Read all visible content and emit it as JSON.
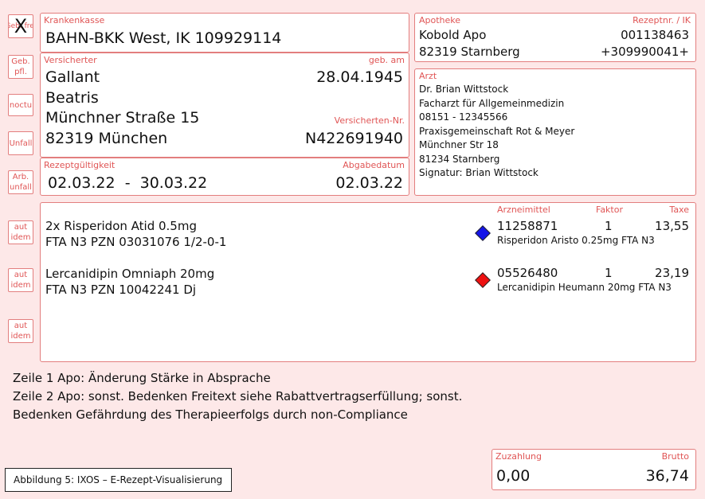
{
  "side_boxes": {
    "gebuehr_frei": {
      "mark": "X",
      "label": "Geb. frei"
    },
    "geb_pfl": [
      "Geb.",
      "pfl."
    ],
    "noctu": "noctu",
    "unfall": "Unfall",
    "arb_unfall": [
      "Arb.",
      "unfall"
    ],
    "aut_idem": [
      "aut",
      "idem"
    ]
  },
  "krankenkasse": {
    "label": "Krankenkasse",
    "value": "BAHN-BKK West, IK 109929114"
  },
  "versicherter": {
    "label": "Versicherter",
    "geb_label": "geb. am",
    "nachname": "Gallant",
    "geb_am": "28.04.1945",
    "vorname": "Beatris",
    "strasse": "Münchner Straße 15",
    "nr_label": "Versicherten-Nr.",
    "ort": "82319 München",
    "nr": "N422691940"
  },
  "gueltigkeit": {
    "label": "Rezeptgültigkeit",
    "value": "02.03.22  -  30.03.22",
    "abgabe_label": "Abgabedatum",
    "abgabe": "02.03.22"
  },
  "apotheke": {
    "label": "Apotheke",
    "ik_label": "Rezeptnr. / IK",
    "name": "Kobold Apo",
    "rezeptnr": "001138463",
    "ort": "82319 Starnberg",
    "ik": "+309990041+"
  },
  "arzt": {
    "label": "Arzt",
    "lines": [
      "Dr. Brian Wittstock",
      "Facharzt für Allgemeinmedizin",
      "08151 - 12345566",
      "Praxisgemeinschaft Rot & Meyer",
      "Münchner Str 18",
      "81234 Starnberg",
      "Signatur: Brian Wittstock"
    ]
  },
  "verordnung": {
    "col_arzneimittel": "Arzneimittel",
    "col_faktor": "Faktor",
    "col_taxe": "Taxe",
    "items": [
      {
        "line1": "2x Risperidon Atid 0.5mg",
        "line2": "FTA N3 PZN 03031076 1/2-0-1",
        "pzn": "11258871",
        "faktor": "1",
        "taxe": "13,55",
        "abgabe_name": "Risperidon Aristo 0.25mg FTA N3",
        "marker_color": "#1515e8"
      },
      {
        "line1": "Lercanidipin Omniaph 20mg",
        "line2": "FTA N3 PZN 10042241 Dj",
        "pzn": "05526480",
        "faktor": "1",
        "taxe": "23,19",
        "abgabe_name": "Lercanidipin Heumann 20mg FTA N3",
        "marker_color": "#ee1111"
      }
    ]
  },
  "notes": [
    "Zeile 1 Apo: Änderung Stärke in Absprache",
    "Zeile 2 Apo: sonst. Bedenken Freitext siehe Rabattvertragserfüllung; sonst.",
    "Bedenken Gefährdung des Therapieerfolgs durch non-Compliance"
  ],
  "zuzahlung": {
    "label": "Zuzahlung",
    "value": "0,00",
    "brutto_label": "Brutto",
    "brutto": "36,74"
  },
  "caption": "Abbildung 5: IXOS – E-Rezept-Visualisierung"
}
